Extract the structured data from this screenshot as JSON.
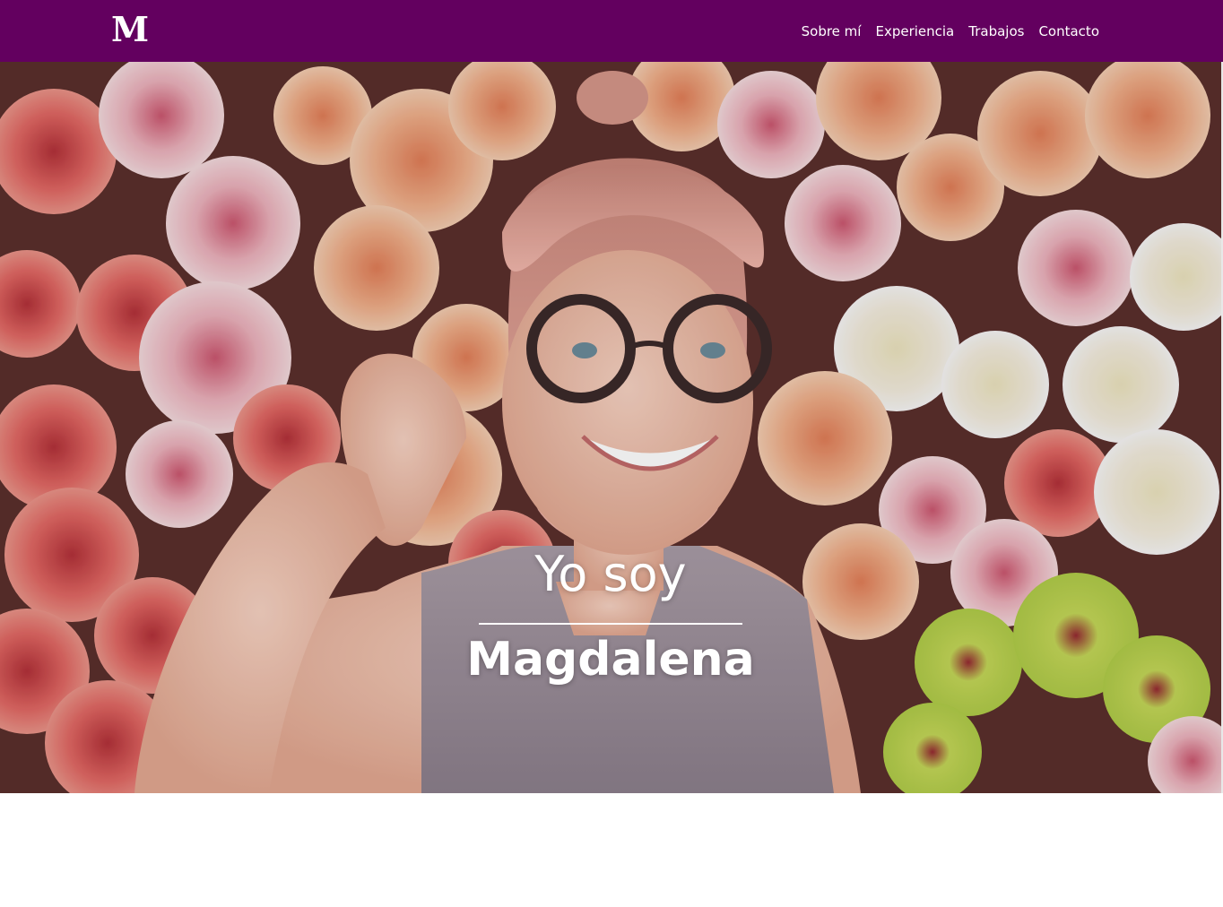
{
  "navbar": {
    "logo": "M",
    "links": [
      {
        "label": "Sobre mí"
      },
      {
        "label": "Experiencia"
      },
      {
        "label": "Trabajos"
      },
      {
        "label": "Contacto"
      }
    ],
    "background_color": "#63005f"
  },
  "hero": {
    "intro": "Yo soy",
    "name": "Magdalena",
    "image": "portrait-woman-glasses-pink-hair-flower-wall"
  },
  "about": {
    "partial_heading": ""
  }
}
